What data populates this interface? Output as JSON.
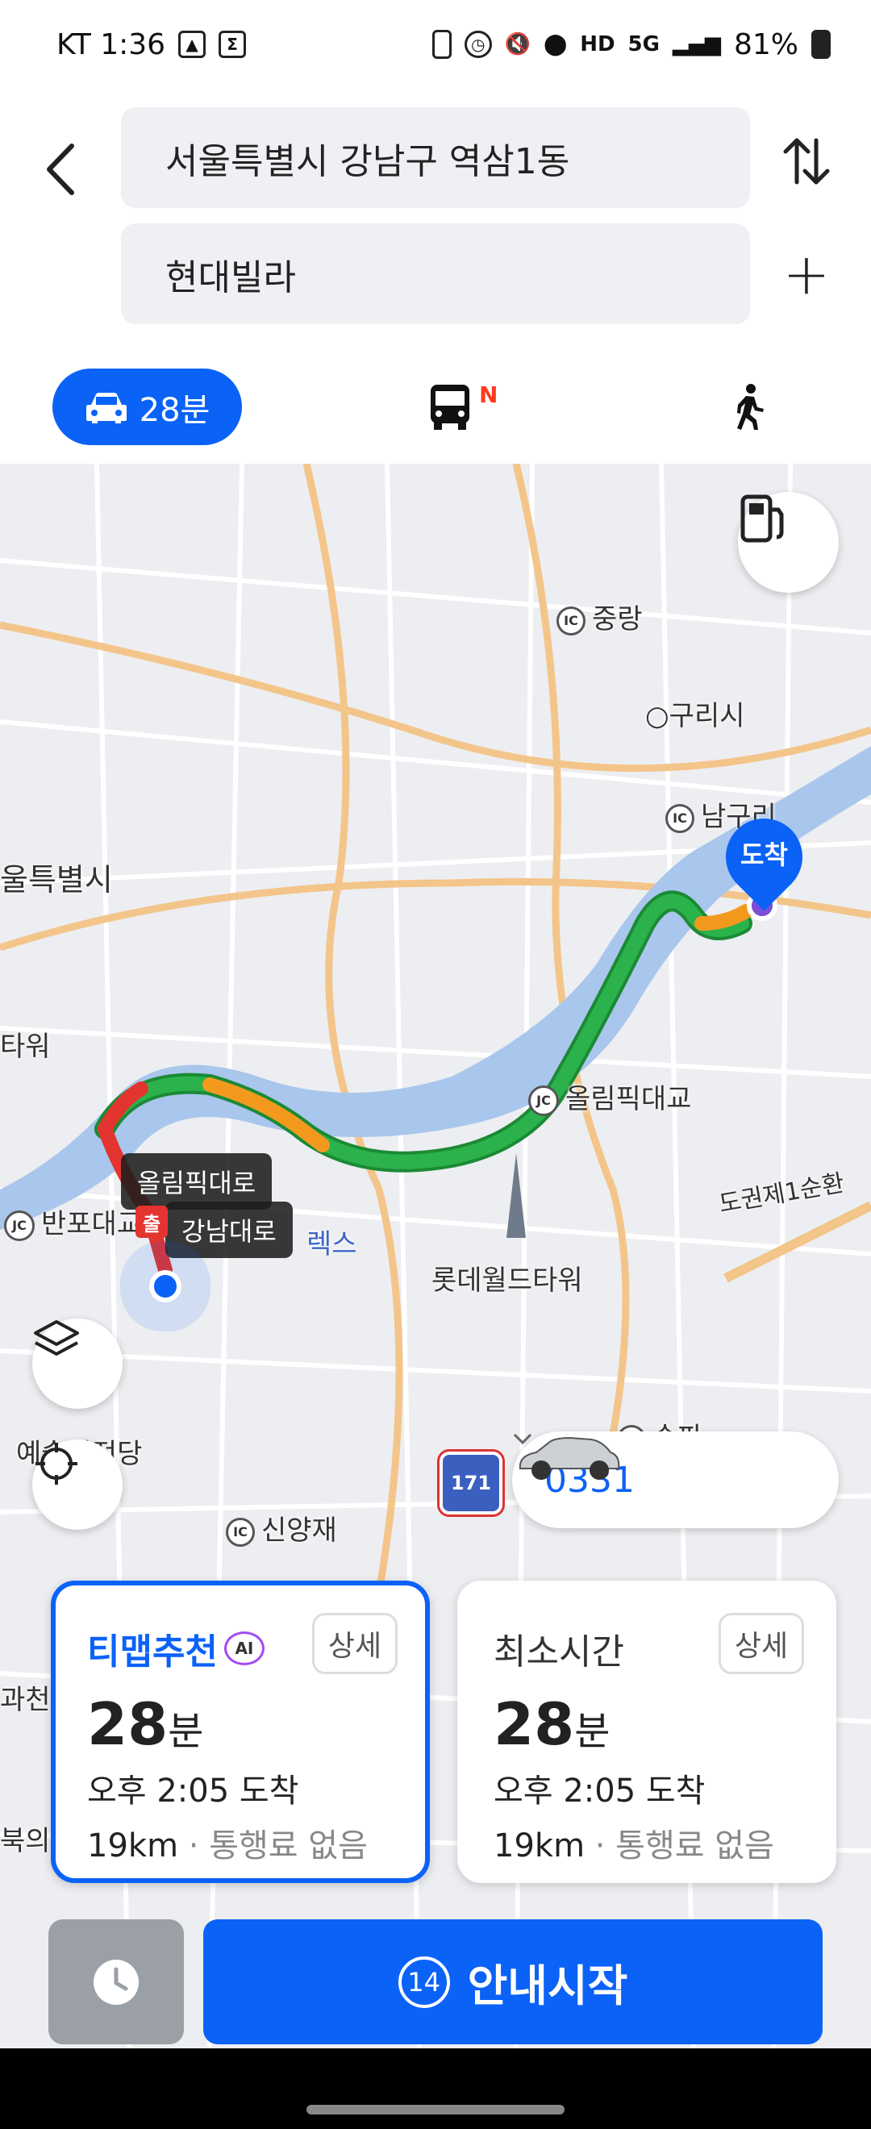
{
  "status_bar": {
    "carrier_time": "KT 1:36",
    "network": "HD",
    "signal": "5G",
    "battery": "81%"
  },
  "route": {
    "origin": "서울특별시 강남구 역삼1동",
    "destination": "현대빌라"
  },
  "modes": {
    "car_time": "28분",
    "transit_badge": "N"
  },
  "map": {
    "labels": {
      "jungnang": "중랑",
      "guri": "구리시",
      "namguri": "남구리",
      "seoul": "울특별시",
      "tower": "타워",
      "olympic_bridge": "올림픽대교",
      "banpo": "반포대교",
      "lotte": "롯데월드타워",
      "expressway": "도권제1순환",
      "arts": "예술의전당",
      "sinyangjae": "신양재",
      "songpa": "송파",
      "gwacheon": "과천",
      "buk": "북의",
      "exs": "렉스"
    },
    "arrival_label": "도착",
    "depart_label": "출",
    "route_tags": {
      "olympic_road": "올림픽대로",
      "gangnam_road": "강남대로"
    },
    "highway_shield": "171",
    "vehicle_plate": "0331"
  },
  "route_options": [
    {
      "title": "티맵추천",
      "ai_badge": "AI",
      "detail": "상세",
      "duration": "28",
      "unit": "분",
      "arrival": "오후 2:05 도착",
      "distance": "19km",
      "toll": "통행료 없음"
    },
    {
      "title": "최소시간",
      "detail": "상세",
      "duration": "28",
      "unit": "분",
      "arrival": "오후 2:05 도착",
      "distance": "19km",
      "toll": "통행료 없음"
    }
  ],
  "start": {
    "count": "14",
    "label": "안내시작"
  },
  "colors": {
    "accent": "#0b62f7",
    "route_green": "#2bb24c",
    "route_orange": "#f39a1e",
    "route_red": "#e3342f",
    "river": "#a9c6ec"
  }
}
